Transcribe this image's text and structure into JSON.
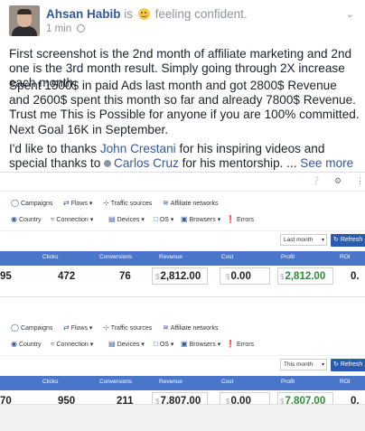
{
  "post": {
    "author": "Ahsan Habib",
    "is_text": "is",
    "feeling": "feeling confident.",
    "time": "1 min",
    "paragraph1": "First screenshot is the 2nd month of affiliate marketing and 2nd one is the 3rd month result. Simply going through 2X increase each month.",
    "paragraph2": "Spent 1500$ in paid Ads last month and got 2800$ Revenue and 2600$ spent this month so far and already 7800$ Revenue. Trust me This is Possible for anyone if you are 100% committed. Next Goal 16K in September.",
    "p3_before": "I'd like to thanks ",
    "p3_link1": "John Crestani",
    "p3_mid": " for his inspiring videos and special thanks to ",
    "p3_link2": "Carlos Cruz",
    "p3_after": " for his mentorship. ... ",
    "see_more": "See more"
  },
  "dashboard_nav": {
    "campaigns": "Campaigns",
    "flows": "Flows",
    "traffic_sources": "Traffic sources",
    "affiliate_networks": "Affiliate networks",
    "country": "Country",
    "connection": "Connection",
    "devices": "Devices",
    "os": "OS",
    "browsers": "Browsers",
    "errors": "Errors",
    "refresh": "Refresh"
  },
  "columns": [
    "Clicks",
    "Conversions",
    "Revenue",
    "Cost",
    "Profit",
    "ROI"
  ],
  "screenshot1": {
    "period": "Last month",
    "first_cell": "95",
    "clicks": "472",
    "conversions": "76",
    "revenue": "2,812.00",
    "cost": "0.00",
    "profit": "2,812.00",
    "roi": "0."
  },
  "screenshot2": {
    "period": "This month",
    "first_cell": "70",
    "clicks": "950",
    "conversions": "211",
    "revenue": "7,807.00",
    "cost": "0.00",
    "profit": "7,807.00",
    "roi": "0."
  },
  "colors": {
    "link": "#365899",
    "table_header": "#4a76c9",
    "refresh_button": "#2a5db0",
    "profit": "#2e8b3a"
  }
}
